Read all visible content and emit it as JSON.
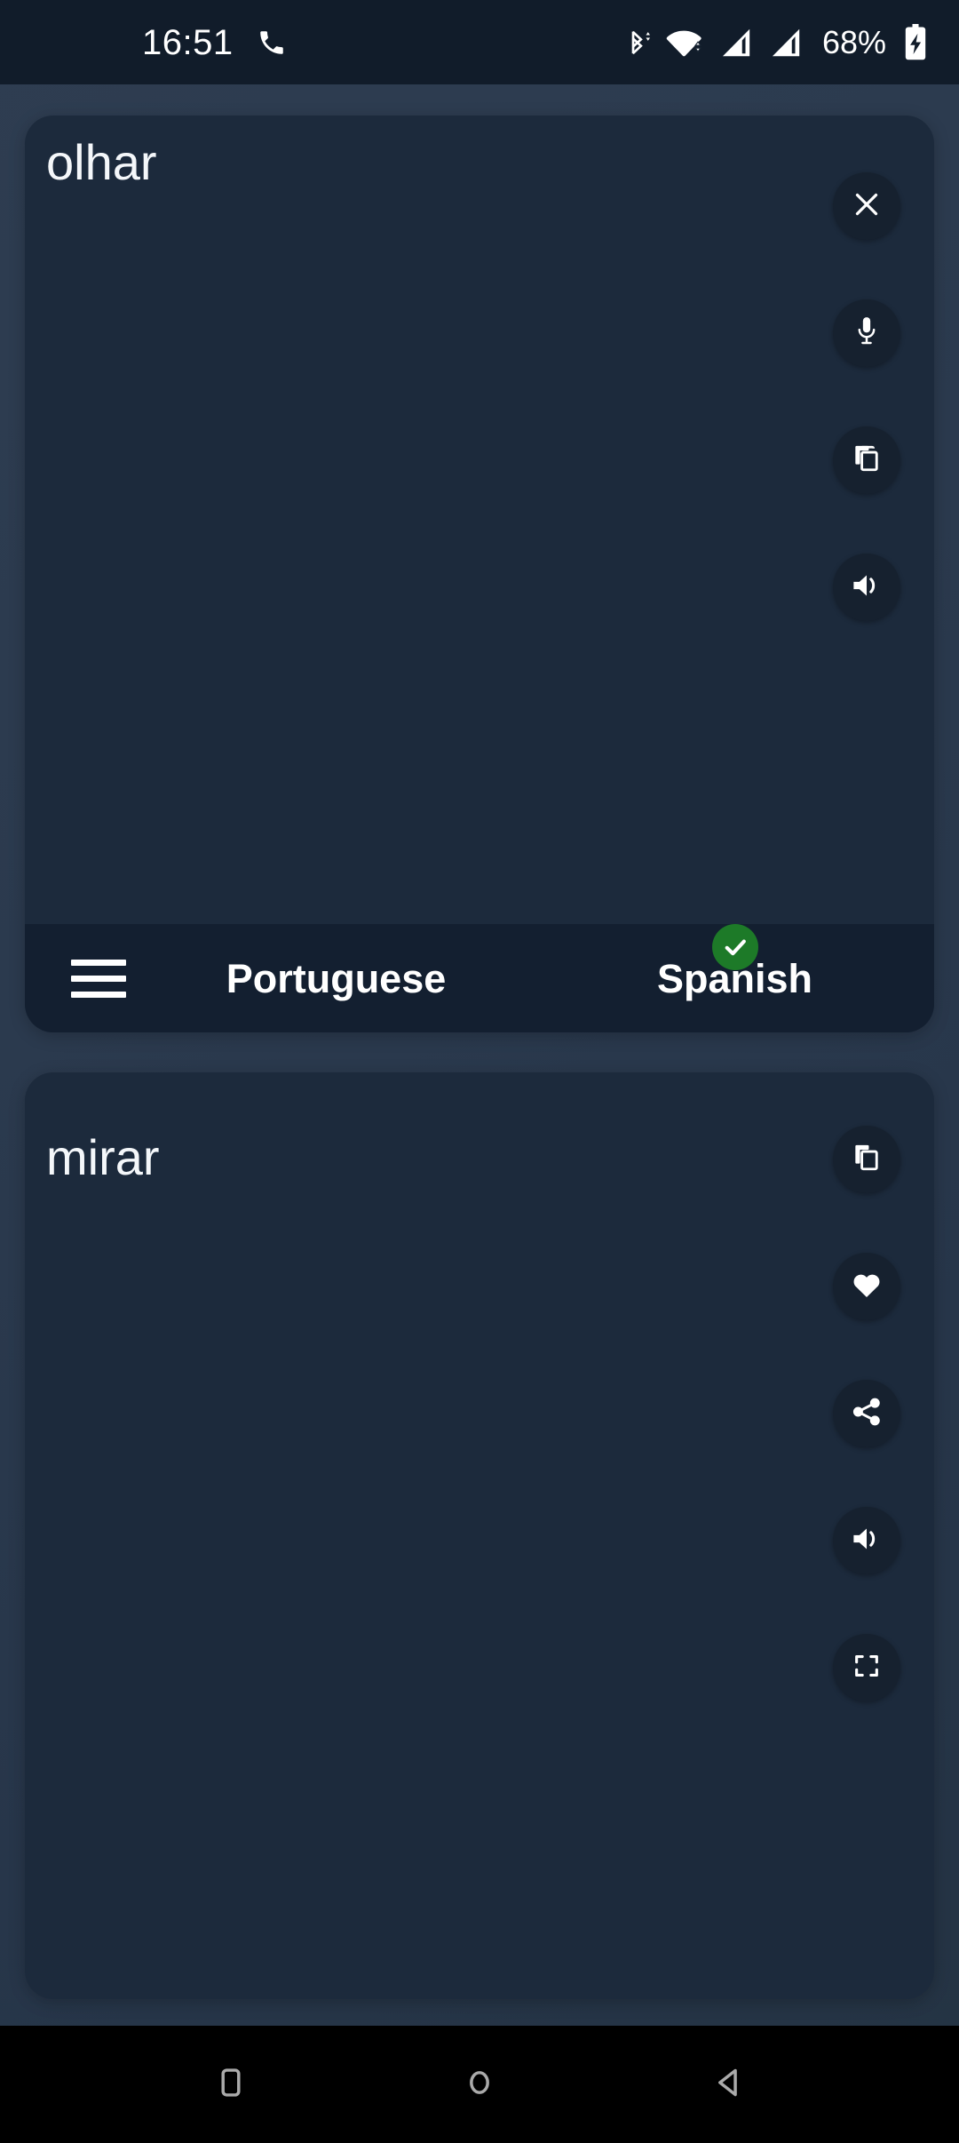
{
  "status_bar": {
    "time": "16:51",
    "battery_percent": "68%",
    "icons": [
      {
        "name": "phone-call-icon"
      },
      {
        "name": "bluetooth-icon"
      },
      {
        "name": "wifi-icon"
      },
      {
        "name": "signal-sim1-icon"
      },
      {
        "name": "signal-sim2-icon"
      },
      {
        "name": "battery-charging-icon"
      }
    ],
    "background_color": "#111c2a"
  },
  "source_card": {
    "text": "olhar",
    "actions": [
      {
        "name": "close-icon",
        "label": "Clear"
      },
      {
        "name": "microphone-icon",
        "label": "Voice input"
      },
      {
        "name": "copy-icon",
        "label": "Copy"
      },
      {
        "name": "speaker-icon",
        "label": "Listen"
      }
    ]
  },
  "language_bar": {
    "menu_label": "Menu",
    "source_language": "Portuguese",
    "target_language": "Spanish",
    "target_verified": true,
    "check_color": "#1d7a28"
  },
  "target_card": {
    "text": "mirar",
    "actions": [
      {
        "name": "copy-icon",
        "label": "Copy"
      },
      {
        "name": "heart-icon",
        "label": "Favorite"
      },
      {
        "name": "share-icon",
        "label": "Share"
      },
      {
        "name": "speaker-icon",
        "label": "Listen"
      },
      {
        "name": "fullscreen-icon",
        "label": "Fullscreen"
      }
    ]
  },
  "nav_bar": {
    "buttons": [
      {
        "name": "recents-icon",
        "label": "Recents"
      },
      {
        "name": "home-icon",
        "label": "Home"
      },
      {
        "name": "back-icon",
        "label": "Back"
      }
    ]
  },
  "theme": {
    "page_background": "#2b3a4e",
    "card_background": "#1c2a3c",
    "button_background": "#16212f",
    "text_color": "#f4f7fa"
  }
}
